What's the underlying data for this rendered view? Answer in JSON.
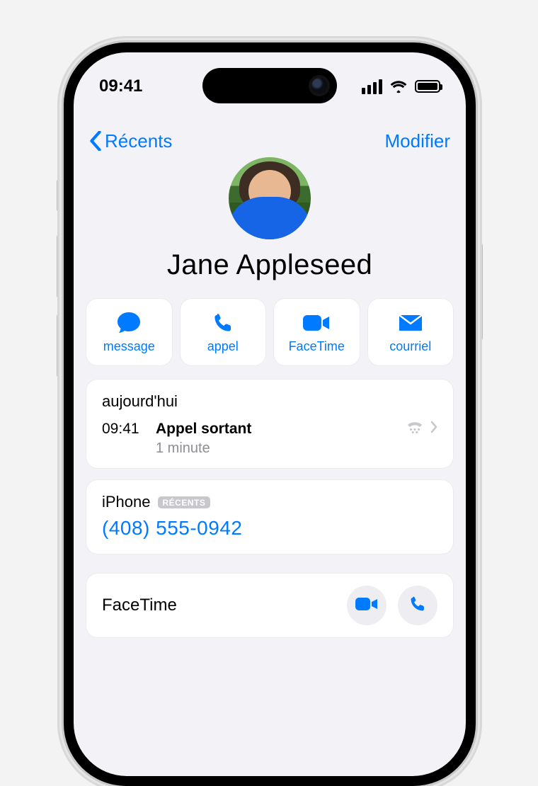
{
  "status": {
    "time": "09:41"
  },
  "nav": {
    "back_label": "Récents",
    "edit_label": "Modifier"
  },
  "contact": {
    "name": "Jane Appleseed"
  },
  "actions": {
    "message": "message",
    "call": "appel",
    "facetime": "FaceTime",
    "mail": "courriel"
  },
  "recent": {
    "section_title": "aujourd'hui",
    "time": "09:41",
    "type": "Appel sortant",
    "duration": "1 minute"
  },
  "phone": {
    "label": "iPhone",
    "badge": "RÉCENTS",
    "number": "(408) 555-0942"
  },
  "facetime": {
    "title": "FaceTime"
  }
}
